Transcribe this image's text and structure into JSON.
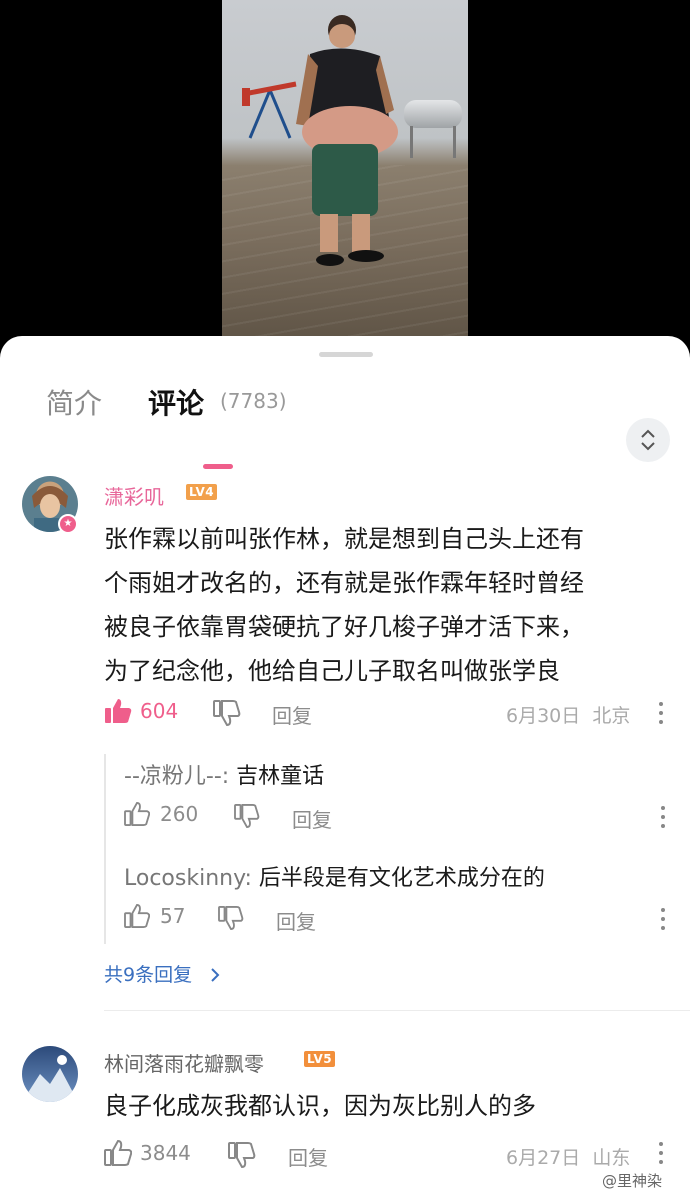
{
  "tabs": {
    "intro_label": "简介",
    "comments_label": "评论",
    "comments_count": "(7783)"
  },
  "comments": [
    {
      "username": "潇彩叽",
      "level": "LV4",
      "text_lines": [
        "张作霖以前叫张作林，就是想到自己头上还有",
        "个雨姐才改名的，还有就是张作霖年轻时曾经",
        "被良子依靠胃袋硬抗了好几梭子弹才活下来，",
        "为了纪念他，他给自己儿子取名叫做张学良"
      ],
      "likes": "604",
      "reply_label": "回复",
      "date": "6月30日",
      "location": "北京",
      "replies": [
        {
          "username": "--凉粉儿--",
          "text": "吉林童话",
          "likes": "260",
          "reply_label": "回复"
        },
        {
          "username": "Locoskinny",
          "text": "后半段是有文化艺术成分在的",
          "likes": "57",
          "reply_label": "回复"
        }
      ],
      "more_replies": "共9条回复",
      "colors": {
        "name": "#e8679a",
        "level_bg": "#f2a04b",
        "like_active": "#ef5e8b"
      }
    },
    {
      "username": "林间落雨花瓣飘零",
      "level": "LV5",
      "text_lines": [
        "良子化成灰我都认识，因为灰比别人的多"
      ],
      "likes": "3844",
      "reply_label": "回复",
      "date": "6月27日",
      "location": "山东",
      "colors": {
        "name": "#666666",
        "level_bg": "#f28f3b"
      }
    }
  ],
  "watermark": "@里神染",
  "icons": [
    "chevron-up-down-icon",
    "thumbs-up-icon",
    "thumbs-down-icon",
    "more-vertical-icon",
    "chevron-right-icon"
  ]
}
